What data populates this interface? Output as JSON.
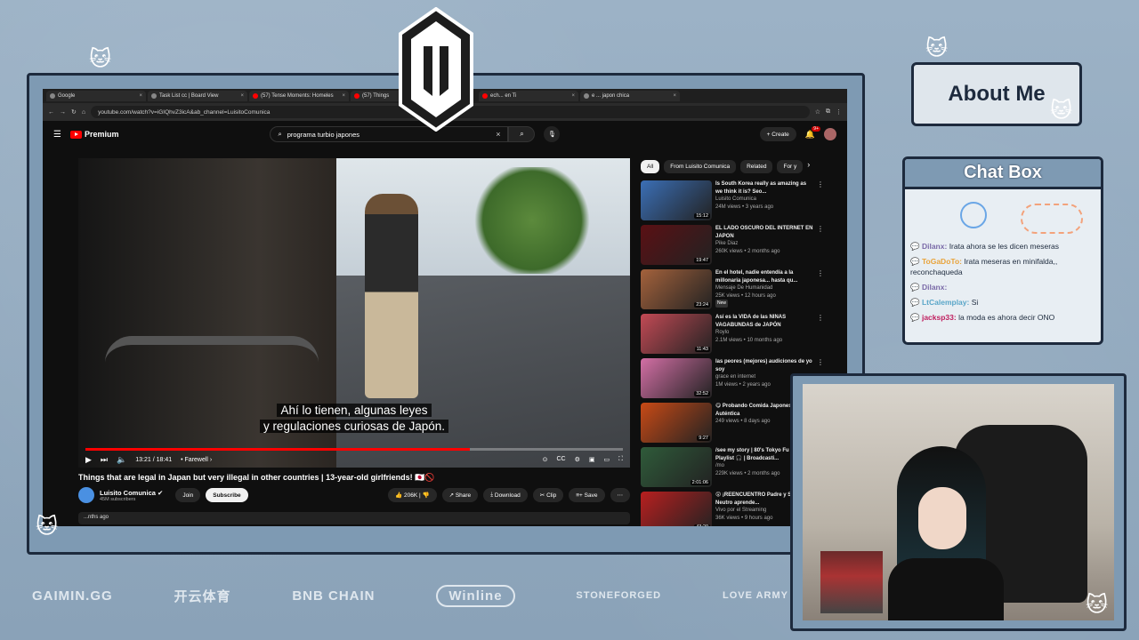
{
  "browser": {
    "tabs": [
      {
        "label": "Google",
        "icon": "google-icon"
      },
      {
        "label": "Task List cc | Board View",
        "icon": "task-icon"
      },
      {
        "label": "(57) Tense Moments: Homeles",
        "icon": "youtube-icon"
      },
      {
        "label": "(57) Things",
        "icon": "youtube-icon"
      },
      {
        "label": "ech... en Ti",
        "icon": "youtube-icon"
      },
      {
        "label": "e ... japon chica",
        "icon": "google-icon"
      }
    ],
    "url": "youtube.com/watch?v=iGIQhvZ3icA&ab_channel=LuisitoComunica"
  },
  "youtube": {
    "logo_text": "Premium",
    "search_value": "programa turbio japones",
    "create_label": "Create",
    "notif_count": "9+",
    "video": {
      "subtitle_line1": "Ahí lo tienen, algunas leyes",
      "subtitle_line2": "y regulaciones curiosas de Japón.",
      "time": "13:21 / 18:41",
      "chapter": "• Farewell ›",
      "progress": 0.715
    },
    "title": "Things that are legal in Japan but very illegal in other countries | 13-year-old girlfriends! 🇯🇵🚫",
    "channel": {
      "name": "Luisito Comunica",
      "subs": "45M subscribers",
      "join": "Join",
      "subscribe": "Subscribe"
    },
    "actions": {
      "likes": "206K",
      "share": "Share",
      "download": "Download",
      "clip": "Clip",
      "save": "Save"
    },
    "description_meta": "...nths ago",
    "chips": [
      "All",
      "From Luisito Comunica",
      "Related",
      "For y"
    ],
    "recommendations": [
      {
        "title": "Is South Korea really as amazing as we think it is? Seo...",
        "channel": "Luisito Comunica",
        "meta": "24M views • 3 years ago",
        "duration": "15:12",
        "color": "#3b6fb6"
      },
      {
        "title": "EL LADO OSCURO DEL INTERNET EN JAPON",
        "channel": "Pike Diaz",
        "meta": "260K views • 2 months ago",
        "duration": "19:47",
        "color": "#5a1014"
      },
      {
        "title": "En el hotel, nadie entendía a la millonaria japonesa... hasta qu...",
        "channel": "Mensaje De Humanidad",
        "meta": "25K views • 12 hours ago",
        "badge": "New",
        "duration": "23:24",
        "color": "#a4623c"
      },
      {
        "title": "Así es la VIDA de las NIÑAS VAGABUNDAS de JAPÓN",
        "channel": "Roylo",
        "meta": "2.1M views • 10 months ago",
        "duration": "11:43",
        "color": "#c24a55"
      },
      {
        "title": "las peores (mejores) audiciones de yo soy",
        "channel": "grace en internet",
        "meta": "1M views • 2 years ago",
        "duration": "32:52",
        "color": "#d36fa5"
      },
      {
        "title": "😋 Probando Comida Japonesa Auténtica",
        "channel": "",
        "meta": "249 views • 8 days ago",
        "duration": "9:27",
        "color": "#c84a16"
      },
      {
        "title": "/see my story | 80's Tokyo Fu Lofi Playlist 🎧 | Broadcasti...",
        "channel": "/mo",
        "meta": "229K views • 2 months ago",
        "duration": "2:01:06",
        "color": "#2f5b3a"
      },
      {
        "title": "😲 ¡REENCUENTRO Padre y Sacha! 😍 Neutro aprende...",
        "channel": "Vivo por el Streaming",
        "meta": "36K views • 9 hours ago",
        "duration": "43:20",
        "color": "#b81f1f"
      }
    ]
  },
  "overlay": {
    "about_title": "About Me",
    "chat_title": "Chat Box",
    "chat_messages": [
      {
        "user": "Dilanx:",
        "text": "Irata ahora se les dicen meseras",
        "color": "#7a6aa8"
      },
      {
        "user": "ToGaDoTo:",
        "text": "Irata meseras en minifalda,, reconchaqueda",
        "color": "#e8a33a"
      },
      {
        "user": "Dilanx:",
        "text": "",
        "color": "#7a6aa8"
      },
      {
        "user": "LtCalemplay:",
        "text": "Si",
        "color": "#5aa6c8"
      },
      {
        "user": "jacksp33:",
        "text": "la moda es ahora decir ONO",
        "color": "#c02060"
      }
    ],
    "sponsors": [
      "GAIMIN.GG",
      "开云体育",
      "BNB CHAIN",
      "Winline",
      "STONEFORGED",
      "LOVE ARMY"
    ]
  }
}
